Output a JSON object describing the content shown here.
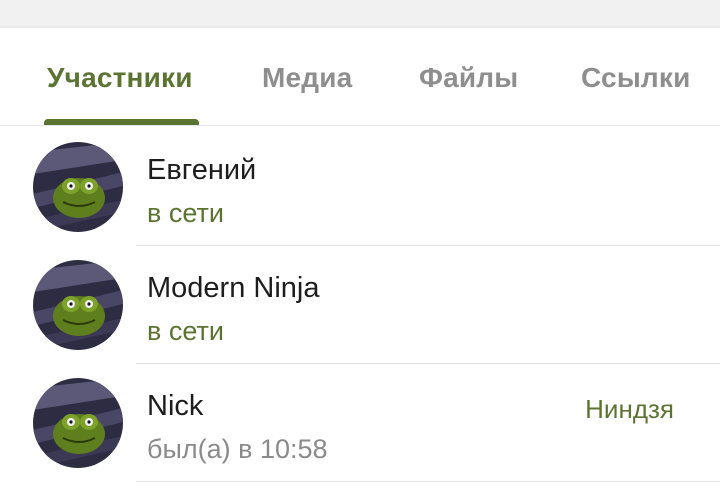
{
  "tabs": [
    {
      "label": "Участники",
      "active": true
    },
    {
      "label": "Медиа",
      "active": false
    },
    {
      "label": "Файлы",
      "active": false
    },
    {
      "label": "Ссылки",
      "active": false
    }
  ],
  "members": [
    {
      "name": "Евгений",
      "status": "в сети",
      "online": true,
      "role": ""
    },
    {
      "name": "Modern Ninja",
      "status": "в сети",
      "online": true,
      "role": ""
    },
    {
      "name": "Nick",
      "status": "был(а) в 10:58",
      "online": false,
      "role": "Ниндзя"
    }
  ],
  "colors": {
    "accent": "#5b7431",
    "inactive_tab": "#8e8e8e",
    "offline_status": "#8a8a8a"
  },
  "icons": {
    "avatar": "kermit-avatar-image"
  }
}
